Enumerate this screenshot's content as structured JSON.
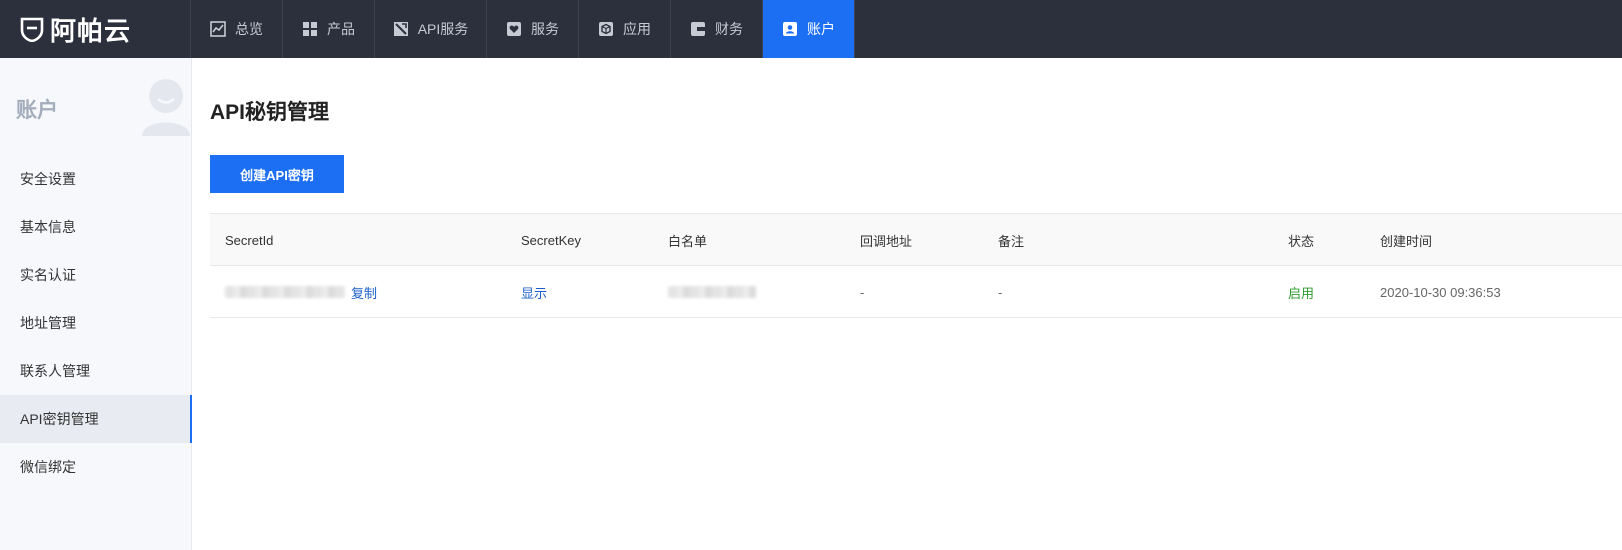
{
  "brand": {
    "name": "阿帕云"
  },
  "nav": {
    "items": [
      {
        "label": "总览",
        "icon": "chart-icon",
        "width": 92
      },
      {
        "label": "产品",
        "icon": "grid-icon",
        "width": 92
      },
      {
        "label": "API服务",
        "icon": "api-icon",
        "width": 112
      },
      {
        "label": "服务",
        "icon": "heart-icon",
        "width": 92
      },
      {
        "label": "应用",
        "icon": "cube-icon",
        "width": 92
      },
      {
        "label": "财务",
        "icon": "wallet-icon",
        "width": 92
      },
      {
        "label": "账户",
        "icon": "user-card-icon",
        "width": 92,
        "active": true
      }
    ]
  },
  "sidebar": {
    "title": "账户",
    "items": [
      {
        "label": "安全设置"
      },
      {
        "label": "基本信息"
      },
      {
        "label": "实名认证"
      },
      {
        "label": "地址管理"
      },
      {
        "label": "联系人管理"
      },
      {
        "label": "API密钥管理",
        "active": true
      },
      {
        "label": "微信绑定"
      }
    ]
  },
  "main": {
    "title": "API秘钥管理",
    "create_label": "创建API密钥",
    "table": {
      "headers": [
        "SecretId",
        "SecretKey",
        "白名单",
        "回调地址",
        "备注",
        "状态",
        "创建时间"
      ],
      "rows": [
        {
          "copy_label": "复制",
          "secret_key_action": "显示",
          "callback": "-",
          "remark": "-",
          "status": "启用",
          "created_at": "2020-10-30 09:36:53"
        }
      ]
    }
  },
  "colors": {
    "topbar": "#2b303c",
    "accent": "#1c6ef2",
    "status_enabled": "#2c9a2c"
  }
}
